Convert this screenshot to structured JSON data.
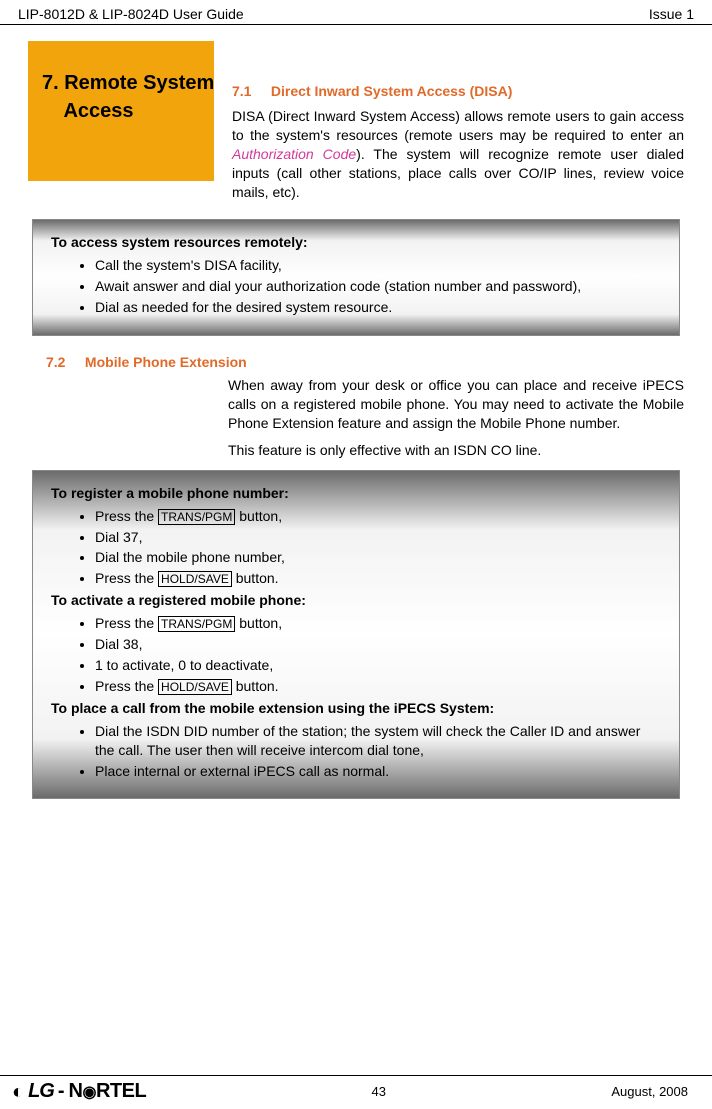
{
  "header": {
    "left": "LIP-8012D & LIP-8024D User Guide",
    "right": "Issue 1"
  },
  "chapter_box": {
    "title": "7. Remote System\n    Access"
  },
  "sections": {
    "s71": {
      "number": "7.1",
      "title": "Direct Inward System Access (DISA)",
      "para_pre": "DISA (Direct Inward System Access) allows remote users to gain access to the system's resources (remote users may be required to enter an ",
      "auth_code": "Authorization Code",
      "para_post": "). The system will recognize remote user dialed inputs (call other stations, place calls over CO/IP lines, review voice mails, etc)."
    },
    "box1": {
      "title": "To access system resources remotely:",
      "items": [
        "Call the system's DISA facility,",
        "Await answer and dial your authorization code (station number and password),",
        "Dial as needed for the desired system resource."
      ]
    },
    "s72": {
      "number": "7.2",
      "title": "Mobile Phone Extension",
      "para1": "When away from your desk or office you can place and receive iPECS calls on a registered mobile phone.  You may need to activate the Mobile Phone Extension feature and assign the Mobile Phone number.",
      "para2": "This feature is only effective with an ISDN CO line."
    },
    "box2": {
      "title1": "To register a mobile phone number:",
      "l1_pre": "Press the ",
      "l1_btn": "TRANS/PGM",
      "l1_post": " button,",
      "l2": "Dial 37,",
      "l3": "Dial the mobile phone number,",
      "l4_pre": "Press the ",
      "l4_btn": "HOLD/SAVE",
      "l4_post": " button.",
      "title2": "To activate a registered mobile phone:",
      "l5_pre": "Press the ",
      "l5_btn": "TRANS/PGM",
      "l5_post": " button,",
      "l6": "Dial 38,",
      "l7": "1 to activate, 0 to deactivate,",
      "l8_pre": "Press the ",
      "l8_btn": "HOLD/SAVE",
      "l8_post": " button.",
      "title3": "To place a call from the mobile extension using the iPECS System:",
      "l9": "Dial the ISDN DID number of the station; the system will check the Caller ID and answer the call. The user then will receive intercom dial tone,",
      "l10": "Place internal or external iPECS call as normal."
    }
  },
  "footer": {
    "logo_lg": "LG",
    "logo_nortel": "N   RTEL",
    "page": "43",
    "date": "August, 2008"
  }
}
